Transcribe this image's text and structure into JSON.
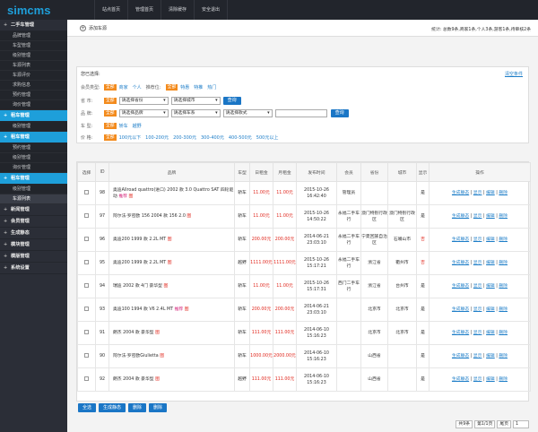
{
  "app": {
    "logo": "simcms"
  },
  "topnav": [
    "站点首页",
    "管理首页",
    "清除缓存",
    "安全退出"
  ],
  "sidebar": [
    {
      "label": "二手车管理",
      "active": false,
      "items": [
        "品牌管理",
        "车型管理",
        "级别管理",
        "车源列表",
        "车源评价",
        "求购信息",
        "预约管理",
        "询价管理"
      ]
    },
    {
      "label": "租车管理",
      "active": true,
      "items": [
        "级别管理"
      ]
    },
    {
      "label": "租车管理",
      "active": true,
      "items": [
        "预约管理",
        "级别管理",
        "询价管理"
      ]
    },
    {
      "label": "租车管理",
      "active": true,
      "items": [
        "级别管理",
        "车源列表"
      ]
    },
    {
      "label": "新闻管理",
      "active": false,
      "items": []
    },
    {
      "label": "会员管理",
      "active": false,
      "items": []
    },
    {
      "label": "生成静态",
      "active": false,
      "items": []
    },
    {
      "label": "模块管理",
      "active": false,
      "items": []
    },
    {
      "label": "模版管理",
      "active": false,
      "items": []
    },
    {
      "label": "系统设置",
      "active": false,
      "items": []
    }
  ],
  "crumb": {
    "add_label": "添加车源",
    "stats": "统计: 总数9条,商家1条,个人3条,游客1条,待审核2条"
  },
  "filter": {
    "title": "您已选择:",
    "clear": "清空条件",
    "r1": {
      "label": "会员类型:",
      "all": "全部",
      "opts": [
        "商家",
        "个人"
      ],
      "label2": "推荐位:",
      "all2": "全部",
      "opts2": [
        "特惠",
        "特推",
        "热门"
      ]
    },
    "r2": {
      "label": "省 市:",
      "all": "全部",
      "s1": "请选择省份",
      "s2": "请选择城市",
      "btn": "查询"
    },
    "r3": {
      "label": "品 牌:",
      "all": "全部",
      "s1": "请选择品牌",
      "s2": "请选择车系",
      "s3": "请选择款式",
      "btn": "查询"
    },
    "r4": {
      "label": "车 型:",
      "all": "全部",
      "opts": [
        "轿车",
        "越野"
      ]
    },
    "r5": {
      "label": "价 格:",
      "all": "全部",
      "opts": [
        "100元以下",
        "100-200元",
        "200-300元",
        "300-400元",
        "400-500元",
        "500元以上"
      ]
    }
  },
  "table": {
    "headers": [
      "选择",
      "ID",
      "品牌",
      "车型",
      "日租金",
      "月租金",
      "发布时间",
      "会员",
      "省份",
      "城市",
      "显示",
      "操作"
    ],
    "ops": [
      "生成静态",
      "显示",
      "编辑",
      "删除"
    ],
    "rows": [
      {
        "id": "98",
        "name": "奥迪Allroad quattro(进口) 2002 款 3.0 Quattro SAT 四轮驱动",
        "tag": "推荐",
        "type": "轿车",
        "day": "11.00元",
        "month": "11.00元",
        "time": "2015-10-26 16:42:40",
        "member": "管理员",
        "prov": "",
        "city": "",
        "show": "是"
      },
      {
        "id": "97",
        "name": "阿尔法·罗密欧 156 2004 款 156 2.0",
        "tag": "",
        "type": "轿车",
        "day": "11.00元",
        "month": "11.00元",
        "time": "2015-10-26 14:50:22",
        "member": "永福二手车行",
        "prov": "澳门特别行政区",
        "city": "澳门特别行政区",
        "show": "是"
      },
      {
        "id": "96",
        "name": "奥迪200 1999 款 2.2L MT",
        "tag": "",
        "type": "轿车",
        "day": "200.00元",
        "month": "200.00元",
        "time": "2014-06-21 23:03:10",
        "member": "永福二手车行",
        "prov": "宁夏回族自治区",
        "city": "石嘴山市",
        "show": "否"
      },
      {
        "id": "95",
        "name": "奥迪200 1999 款 2.2L MT",
        "tag": "",
        "type": "越野",
        "day": "1111.00元",
        "month": "1111.00元",
        "time": "2015-10-26 15:17:21",
        "member": "永福二手车行",
        "prov": "浙江省",
        "city": "衢州市",
        "show": "否"
      },
      {
        "id": "94",
        "name": "瑞迪 2002 款 4门 豪华型",
        "tag": "",
        "type": "轿车",
        "day": "11.00元",
        "month": "11.00元",
        "time": "2015-10-26 15:17:31",
        "member": "西门二手车行",
        "prov": "浙江省",
        "city": "台州市",
        "show": "是"
      },
      {
        "id": "93",
        "name": "奥迪100 1994 款 V6 2.4L MT",
        "tag": "推荐",
        "type": "轿车",
        "day": "200.00元",
        "month": "200.00元",
        "time": "2014-06-21 23:03:10",
        "member": "",
        "prov": "北京市",
        "city": "北京市",
        "show": "是"
      },
      {
        "id": "91",
        "name": "朗杰 2004 款 豪华型",
        "tag": "",
        "type": "轿车",
        "day": "111.00元",
        "month": "111.00元",
        "time": "2014-06-10 15:16:23",
        "member": "",
        "prov": "北京市",
        "city": "北京市",
        "show": "是"
      },
      {
        "id": "90",
        "name": "阿尔法·罗密欧Giulietta",
        "tag": "",
        "type": "轿车",
        "day": "1000.00元",
        "month": "2000.00元",
        "time": "2014-06-10 15:16:23",
        "member": "",
        "prov": "山西省",
        "city": "",
        "show": "是"
      },
      {
        "id": "92",
        "name": "朗杰 2004 款 豪华型",
        "tag": "",
        "type": "越野",
        "day": "111.00元",
        "month": "111.00元",
        "time": "2014-06-10 15:16:23",
        "member": "",
        "prov": "山西省",
        "city": "",
        "show": "是"
      }
    ]
  },
  "bottom": [
    "全选",
    "生成静态",
    "删除",
    "删除"
  ],
  "pager": {
    "total": "共9条",
    "page": "第1/1页",
    "first": "尾页",
    "sel": "1"
  }
}
